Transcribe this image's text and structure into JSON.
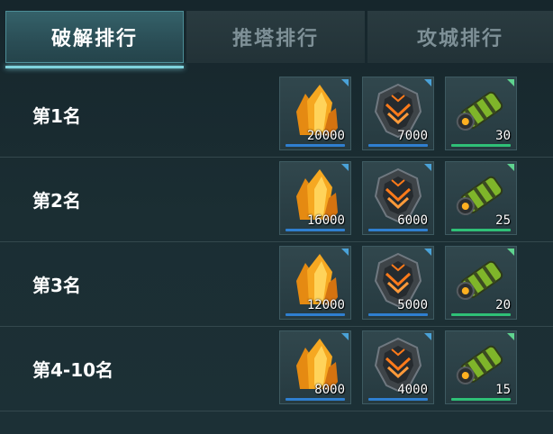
{
  "tabs": [
    {
      "label": "破解排行"
    },
    {
      "label": "推塔排行"
    },
    {
      "label": "攻城排行"
    }
  ],
  "rows": [
    {
      "rank": "第1名",
      "rewards": {
        "crystal": "20000",
        "emblem": "7000",
        "cannon": "30"
      }
    },
    {
      "rank": "第2名",
      "rewards": {
        "crystal": "16000",
        "emblem": "6000",
        "cannon": "25"
      }
    },
    {
      "rank": "第3名",
      "rewards": {
        "crystal": "12000",
        "emblem": "5000",
        "cannon": "20"
      }
    },
    {
      "rank": "第4-10名",
      "rewards": {
        "crystal": "8000",
        "emblem": "4000",
        "cannon": "15"
      }
    }
  ],
  "icons": {
    "crystal": "orange-crystal-icon",
    "emblem": "dark-shield-emblem-icon",
    "cannon": "green-cannon-icon"
  },
  "colors": {
    "active_tab": "#2a4d55",
    "accent": "#7fd3dd",
    "rarity_blue": "#2f7fd0",
    "rarity_green": "#2fc077"
  }
}
